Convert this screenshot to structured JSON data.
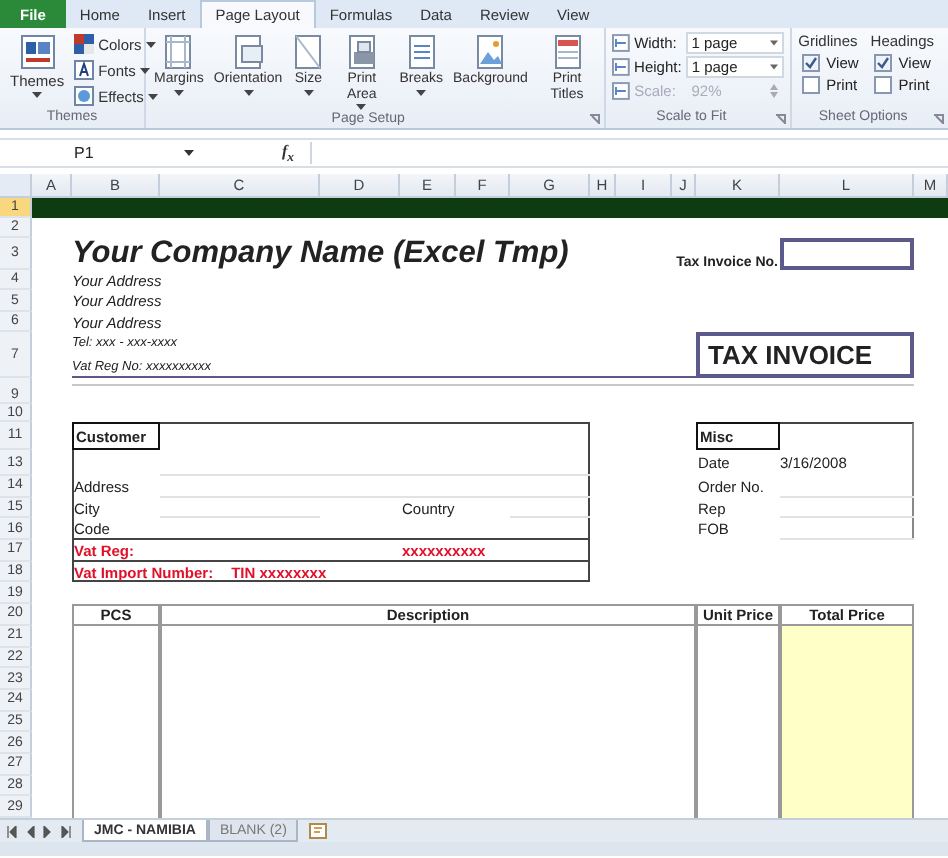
{
  "ribbon": {
    "tabs": [
      {
        "label": "File",
        "kind": "file",
        "selected": false
      },
      {
        "label": "Home",
        "kind": "tab",
        "selected": false
      },
      {
        "label": "Insert",
        "kind": "tab",
        "selected": false
      },
      {
        "label": "Page Layout",
        "kind": "tab",
        "selected": true
      },
      {
        "label": "Formulas",
        "kind": "tab",
        "selected": false
      },
      {
        "label": "Data",
        "kind": "tab",
        "selected": false
      },
      {
        "label": "Review",
        "kind": "tab",
        "selected": false
      },
      {
        "label": "View",
        "kind": "tab",
        "selected": false
      }
    ],
    "themes_group": {
      "label": "Themes",
      "button": {
        "label": "Themes",
        "dropdown": true
      },
      "items": [
        {
          "label": "Colors",
          "dropdown": true
        },
        {
          "label": "Fonts",
          "dropdown": true
        },
        {
          "label": "Effects",
          "dropdown": true
        }
      ]
    },
    "page_setup": {
      "label": "Page Setup",
      "buttons": [
        {
          "label": "Margins",
          "dropdown": true
        },
        {
          "label": "Orientation",
          "dropdown": true
        },
        {
          "label": "Size",
          "dropdown": true
        },
        {
          "label": "Print Area",
          "dropdown": true
        },
        {
          "label": "Breaks",
          "dropdown": true
        },
        {
          "label": "Background",
          "dropdown": false
        },
        {
          "label": "Print Titles",
          "dropdown": false
        }
      ]
    },
    "scale_to_fit": {
      "label": "Scale to Fit",
      "rows": [
        {
          "kind": "select",
          "label": "Width:",
          "value": "1 page",
          "disabled": false
        },
        {
          "kind": "select",
          "label": "Height:",
          "value": "1 page",
          "disabled": false
        },
        {
          "kind": "spin",
          "label": "Scale:",
          "value": "92%",
          "disabled": true
        }
      ]
    },
    "sheet_options": {
      "label": "Sheet Options",
      "columns": [
        {
          "heading": "Gridlines",
          "options": [
            {
              "label": "View",
              "checked": true
            },
            {
              "label": "Print",
              "checked": false
            }
          ]
        },
        {
          "heading": "Headings",
          "options": [
            {
              "label": "View",
              "checked": true
            },
            {
              "label": "Print",
              "checked": false
            }
          ]
        }
      ]
    }
  },
  "formula_bar": {
    "name_box": "P1",
    "function_label": "f$_{x}$"
  },
  "sheet": {
    "columns": [
      "A",
      "B",
      "C",
      "D",
      "E",
      "F",
      "G",
      "H",
      "I",
      "J",
      "K",
      "L",
      "M"
    ],
    "row_headers": [
      "1",
      "2",
      "3",
      "4",
      "5",
      "6",
      "7",
      "9",
      "10",
      "11",
      "13",
      "14",
      "15",
      "16",
      "17",
      "18",
      "19",
      "20",
      "21",
      "22",
      "23",
      "24",
      "25",
      "26",
      "27",
      "28",
      "29"
    ],
    "header": {
      "company": "Your Company Name (Excel Tmp)",
      "address_lines": [
        "Your Address",
        "Your Address",
        "Your Address"
      ],
      "tel": "Tel:  xxx - xxx-xxxx",
      "vat_reg_no": "Vat Reg No:  xxxxxxxxxx",
      "invoice_no_label": "Tax Invoice No.",
      "title": "TAX INVOICE"
    },
    "customer": {
      "heading": "Customer",
      "address_label": "Address",
      "city_label": "City",
      "country_label": "Country",
      "code_label": "Code",
      "vat_reg_label": "Vat Reg:",
      "vat_reg_value": "xxxxxxxxxx",
      "vat_import_label": "Vat Import Number:",
      "vat_import_value": "TIN xxxxxxxx"
    },
    "misc": {
      "heading": "Misc",
      "rows": [
        {
          "label": "Date",
          "value": "3/16/2008"
        },
        {
          "label": "Order No."
        },
        {
          "label": "Rep"
        },
        {
          "label": "FOB"
        }
      ]
    },
    "items_table": {
      "columns": [
        "PCS",
        "Description",
        "Unit Price",
        "Total Price"
      ]
    }
  },
  "sheet_tabs": [
    {
      "label": "JMC - NAMIBIA",
      "selected": true
    },
    {
      "label": "BLANK (2)",
      "selected": false
    }
  ]
}
